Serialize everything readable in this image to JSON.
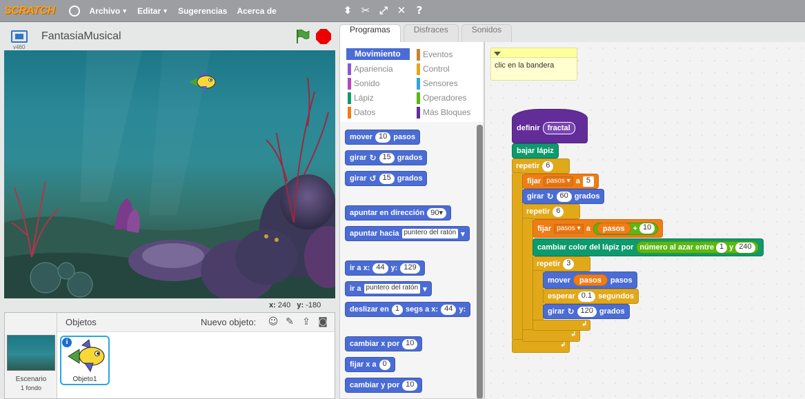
{
  "menu": {
    "logo": "SCRATCH",
    "items": [
      {
        "label": "Archivo",
        "dropdown": true
      },
      {
        "label": "Editar",
        "dropdown": true
      },
      {
        "label": "Sugerencias",
        "dropdown": false
      },
      {
        "label": "Acerca de",
        "dropdown": false
      }
    ],
    "tools": [
      "duplicate-icon",
      "delete-icon",
      "grow-icon",
      "shrink-icon",
      "help-icon"
    ]
  },
  "stage": {
    "version": "v460",
    "project_title": "FantasiaMusical",
    "coords": {
      "x_label": "x:",
      "x": "240",
      "y_label": "y:",
      "y": "-180"
    }
  },
  "sprites": {
    "stage_label": "Escenario",
    "stage_sub": "1 fondo",
    "objects_title": "Objetos",
    "new_object_label": "Nuevo objeto:",
    "sprite_name": "Objeto1"
  },
  "tabs": [
    {
      "label": "Programas",
      "active": true
    },
    {
      "label": "Disfraces",
      "active": false
    },
    {
      "label": "Sonidos",
      "active": false
    }
  ],
  "categories": [
    {
      "label": "Movimiento",
      "color": "#4a6cd4",
      "active": true
    },
    {
      "label": "Eventos",
      "color": "#c88330"
    },
    {
      "label": "Apariencia",
      "color": "#8a55d7"
    },
    {
      "label": "Control",
      "color": "#e1a91a"
    },
    {
      "label": "Sonido",
      "color": "#bb42c3"
    },
    {
      "label": "Sensores",
      "color": "#2ca5e2"
    },
    {
      "label": "Lápiz",
      "color": "#0e9a6c"
    },
    {
      "label": "Operadores",
      "color": "#5cb712"
    },
    {
      "label": "Datos",
      "color": "#ee7d16"
    },
    {
      "label": "Más Bloques",
      "color": "#632d99"
    }
  ],
  "palette": {
    "move": {
      "t1": "mover",
      "v": "10",
      "t2": "pasos"
    },
    "turn_right": {
      "t1": "girar",
      "v": "15",
      "t2": "grados"
    },
    "turn_left": {
      "t1": "girar",
      "v": "15",
      "t2": "grados"
    },
    "point_dir": {
      "t1": "apuntar en dirección",
      "v": "90▾"
    },
    "point_towards": {
      "t1": "apuntar hacia",
      "v": "puntero del ratón"
    },
    "goto_xy": {
      "t1": "ir a x:",
      "x": "44",
      "t2": "y:",
      "y": "129"
    },
    "goto": {
      "t1": "ir a",
      "v": "puntero del ratón"
    },
    "glide": {
      "t1": "deslizar en",
      "v": "1",
      "t2": "segs a x:",
      "x": "44",
      "t3": "y:"
    },
    "change_x": {
      "t1": "cambiar x por",
      "v": "10"
    },
    "set_x": {
      "t1": "fijar x a",
      "v": "0"
    },
    "change_y": {
      "t1": "cambiar y por",
      "v": "10"
    }
  },
  "comment": "clic en la bandera",
  "script": {
    "define": {
      "t": "definir",
      "name": "fractal"
    },
    "pen_down": "bajar lápiz",
    "repeat1": {
      "t": "repetir",
      "v": "6"
    },
    "set_var": {
      "t": "fijar",
      "var": "pasos",
      "t2": "a",
      "v": "5"
    },
    "turn60": {
      "t": "girar",
      "v": "60",
      "t2": "grados"
    },
    "repeat2": {
      "t": "repetir",
      "v": "6"
    },
    "set_var2": {
      "t": "fijar",
      "var": "pasos",
      "t2": "a",
      "rep": "pasos",
      "op": "+",
      "v": "10"
    },
    "change_color": {
      "t": "cambiar color del lápiz por",
      "rand": "número al azar entre",
      "a": "1",
      "y": "y",
      "b": "240"
    },
    "repeat3": {
      "t": "repetir",
      "v": "3"
    },
    "move": {
      "t": "mover",
      "rep": "pasos",
      "t2": "pasos"
    },
    "wait": {
      "t": "esperar",
      "v": "0.1",
      "t2": "segundos"
    },
    "turn120": {
      "t": "girar",
      "v": "120",
      "t2": "grados"
    }
  }
}
